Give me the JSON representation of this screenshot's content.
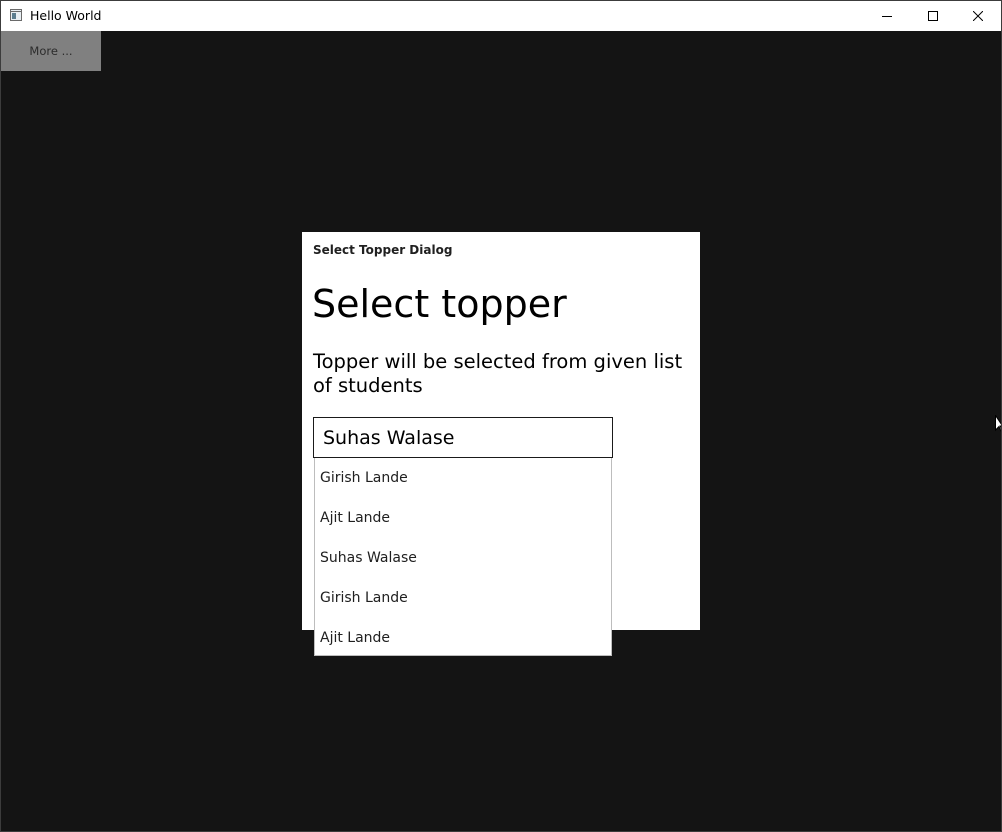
{
  "window": {
    "title": "Hello World",
    "icon": "window-app-icon"
  },
  "toolbar": {
    "more_label": "More ..."
  },
  "dialog": {
    "title": "Select Topper Dialog",
    "heading": "Select topper",
    "description": "Topper will be selected from given list of students"
  },
  "combo": {
    "selected": "Suhas Walase",
    "options": [
      "Girish Lande",
      "Ajit Lande",
      "Suhas Walase",
      "Girish Lande",
      "Ajit Lande"
    ]
  },
  "colors": {
    "background": "#141414",
    "titlebar": "#ffffff",
    "more_button": "#808080",
    "dialog": "#ffffff"
  }
}
